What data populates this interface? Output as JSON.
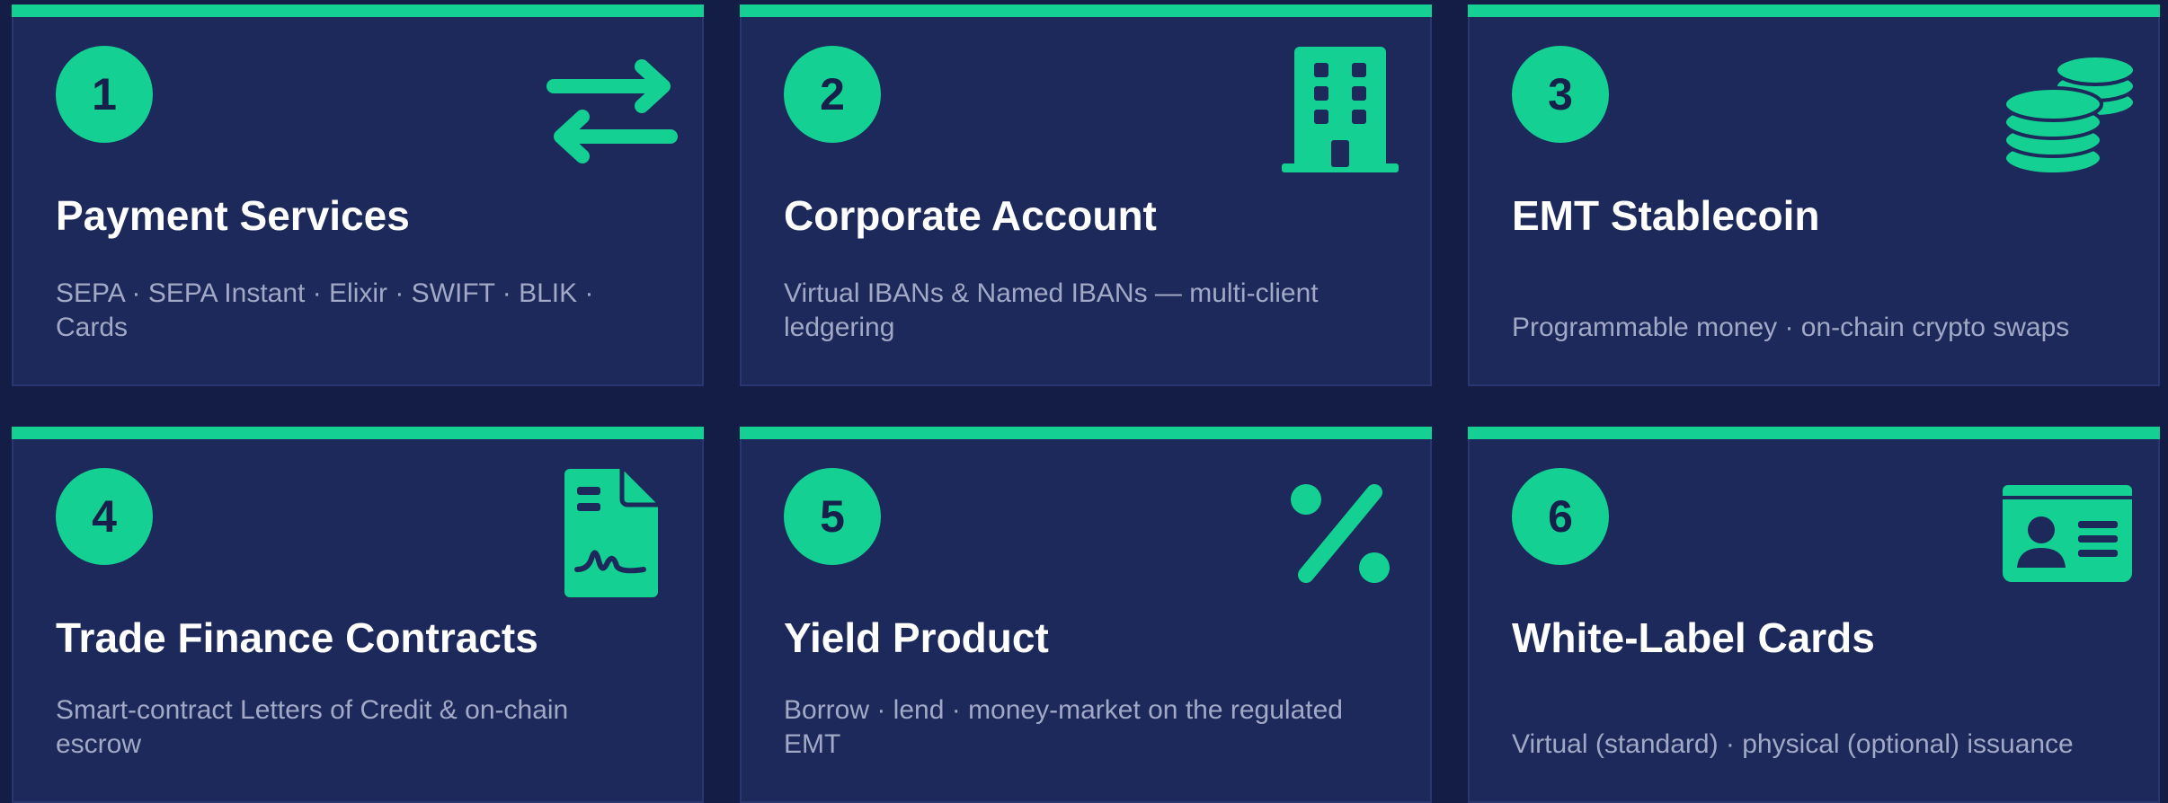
{
  "colors": {
    "background": "#141d45",
    "card": "#1d285b",
    "accent": "#14d093",
    "title": "#ffffff",
    "description": "#a2a9c6"
  },
  "cards": [
    {
      "number": "1",
      "title": "Payment Services",
      "description": "SEPA · SEPA Instant · Elixir · SWIFT · BLIK · Cards",
      "icon": "arrows-exchange-icon"
    },
    {
      "number": "2",
      "title": "Corporate Account",
      "description": "Virtual IBANs & Named IBANs — multi-client ledgering",
      "icon": "office-building-icon"
    },
    {
      "number": "3",
      "title": "EMT Stablecoin",
      "description": "Programmable money · on-chain crypto swaps",
      "icon": "coins-stack-icon"
    },
    {
      "number": "4",
      "title": "Trade Finance Contracts",
      "description": "Smart-contract Letters of Credit & on-chain escrow",
      "icon": "signed-contract-icon"
    },
    {
      "number": "5",
      "title": "Yield Product",
      "description": "Borrow · lend · money-market on the regulated EMT",
      "icon": "percent-icon"
    },
    {
      "number": "6",
      "title": "White-Label Cards",
      "description": "Virtual (standard) · physical (optional) issuance",
      "icon": "id-card-icon"
    }
  ]
}
